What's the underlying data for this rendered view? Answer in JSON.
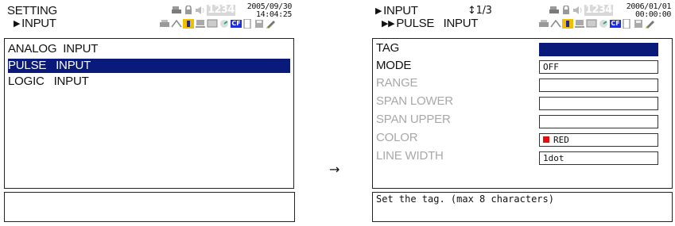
{
  "left": {
    "breadcrumb_line1": "SETTING",
    "breadcrumb_line2": "INPUT",
    "date": "2005/09/30",
    "time": "14:04:25",
    "counter": "1234",
    "menu": [
      {
        "label": "ANALOG  INPUT",
        "selected": false
      },
      {
        "label": "PULSE   INPUT",
        "selected": true
      },
      {
        "label": "LOGIC   INPUT",
        "selected": false
      }
    ],
    "status": ""
  },
  "transition_arrow": "→",
  "right": {
    "breadcrumb_line1": "INPUT",
    "breadcrumb_line2": "PULSE   INPUT",
    "page_indicator": "↕1/3",
    "date": "2006/01/01",
    "time": "00:00:00",
    "counter": "1234",
    "fields": [
      {
        "label": "TAG",
        "value": "",
        "disabled": false,
        "focused": true
      },
      {
        "label": "MODE",
        "value": "OFF",
        "disabled": false
      },
      {
        "label": "RANGE",
        "value": "",
        "disabled": true
      },
      {
        "label": "SPAN LOWER",
        "value": "",
        "disabled": true
      },
      {
        "label": "SPAN UPPER",
        "value": "",
        "disabled": true
      },
      {
        "label": "COLOR",
        "value": "RED",
        "disabled": true,
        "swatch": "#e01010"
      },
      {
        "label": "LINE WIDTH",
        "value": "1dot",
        "disabled": true
      }
    ],
    "status": "Set the tag. (max 8 characters)"
  },
  "colors": {
    "selection": "#0a1a7a",
    "disabled_text": "#a8a8a8",
    "cf_badge": "#1d2bd8",
    "red_swatch": "#e01010"
  },
  "icons": {
    "cf_label": "CF"
  }
}
